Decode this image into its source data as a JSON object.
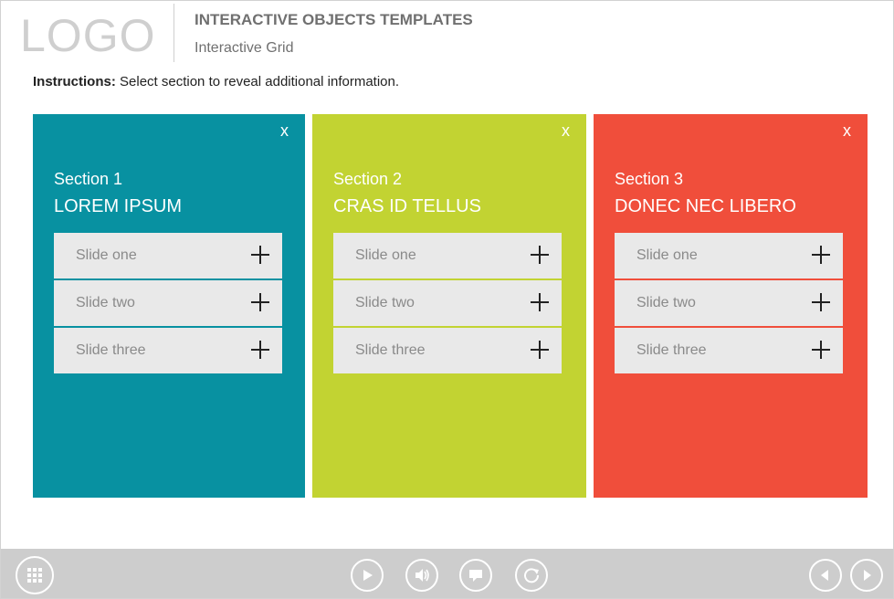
{
  "header": {
    "logo": "LOGO",
    "title": "INTERACTIVE OBJECTS TEMPLATES",
    "subtitle": "Interactive Grid"
  },
  "instructions": {
    "label": "Instructions:",
    "text": " Select section to reveal additional information."
  },
  "sections": [
    {
      "number": "Section 1",
      "title": "LOREM IPSUM",
      "close": "x",
      "color": "#0891a1",
      "slides": [
        {
          "label": "Slide one",
          "icon": "plus-icon"
        },
        {
          "label": "Slide two",
          "icon": "plus-icon"
        },
        {
          "label": "Slide three",
          "icon": "plus-icon"
        }
      ]
    },
    {
      "number": "Section 2",
      "title": "CRAS ID TELLUS",
      "close": "x",
      "color": "#c2d332",
      "slides": [
        {
          "label": "Slide one",
          "icon": "plus-icon"
        },
        {
          "label": "Slide two",
          "icon": "plus-icon"
        },
        {
          "label": "Slide three",
          "icon": "plus-icon"
        }
      ]
    },
    {
      "number": "Section 3",
      "title": "DONEC NEC LIBERO",
      "close": "x",
      "color": "#f04e3b",
      "slides": [
        {
          "label": "Slide one",
          "icon": "plus-icon"
        },
        {
          "label": "Slide two",
          "icon": "plus-icon"
        },
        {
          "label": "Slide three",
          "icon": "plus-icon"
        }
      ]
    }
  ],
  "footer": {
    "buttons": [
      "menu-grid-icon",
      "play-icon",
      "volume-icon",
      "captions-icon",
      "replay-icon",
      "previous-icon",
      "next-icon"
    ]
  }
}
